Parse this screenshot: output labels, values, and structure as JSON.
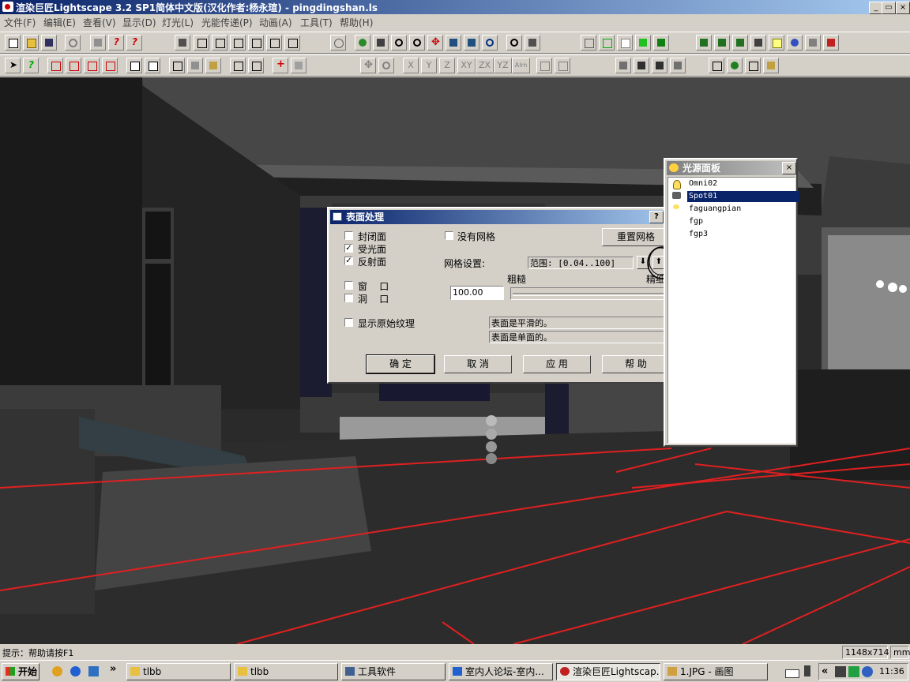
{
  "window": {
    "title": "渲染巨匠Lightscape 3.2 SP1简体中文版(汉化作者:杨永瑄) - pingdingshan.ls",
    "min_label": "_",
    "max_label": "▭",
    "close_label": "×"
  },
  "menu": [
    "文件(F)",
    "编辑(E)",
    "查看(V)",
    "显示(D)",
    "灯光(L)",
    "光能传递(P)",
    "动画(A)",
    "工具(T)",
    "帮助(H)"
  ],
  "toolbar2_text": [
    "X",
    "Y",
    "Z",
    "XY",
    "ZX",
    "YZ",
    "Alm"
  ],
  "surface_dialog": {
    "title": "表面处理",
    "help_label": "?",
    "close_label": "×",
    "checkboxes": [
      {
        "label": "封闭面",
        "checked": false
      },
      {
        "label": "受光面",
        "checked": true
      },
      {
        "label": "反射面",
        "checked": true
      },
      {
        "label": "窗    口",
        "checked": false
      },
      {
        "label": "洞    口",
        "checked": false
      },
      {
        "label": "显示原始纹理",
        "checked": false
      },
      {
        "label": "没有网格",
        "checked": false
      }
    ],
    "check_mark": "✓",
    "reset_mesh_label": "重置网格",
    "mesh_settings_label": "网格设置:",
    "range_label": "范围: [0.04..100]",
    "coarse_label": "粗糙",
    "fine_label": "精细",
    "mesh_value": "100.00",
    "status_smooth": "表面是平滑的。",
    "status_single": "表面是单面的。",
    "ok_label": "确  定",
    "cancel_label": "取  消",
    "apply_label": "应  用",
    "help_button_label": "帮  助"
  },
  "light_panel": {
    "title": "光源面板",
    "close_label": "×",
    "items": [
      "Omni02",
      "Spot01",
      "faguangpian",
      "fgp",
      "fgp3"
    ],
    "selected_index": 1
  },
  "status": {
    "hint": "提示：帮助请按F1",
    "resolution": "1148x714",
    "unit": "mm"
  },
  "taskbar": {
    "start_label": "开始",
    "chevron": "»",
    "tasks": [
      "tlbb",
      "tlbb",
      "工具软件",
      "室内人论坛-室内...",
      "渲染巨匠Lightscap...",
      "1.JPG - 画图"
    ],
    "active_index": 4,
    "tray_chevron": "«",
    "clock": "11:36"
  }
}
